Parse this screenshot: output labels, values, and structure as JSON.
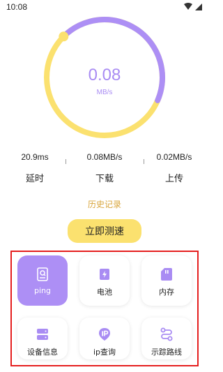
{
  "status_bar": {
    "time": "10:08"
  },
  "gauge": {
    "value": "0.08",
    "unit": "MB/s",
    "level_percent": 88
  },
  "stats": [
    {
      "value": "20.9ms",
      "label": "延时"
    },
    {
      "value": "0.08MB/s",
      "label": "下载"
    },
    {
      "value": "0.02MB/s",
      "label": "上传"
    }
  ],
  "history_label": "历史记录",
  "test_button_label": "立即测速",
  "tools": [
    {
      "label": "ping",
      "icon": "document-search-icon",
      "active": true
    },
    {
      "label": "电池",
      "icon": "battery-icon",
      "active": false
    },
    {
      "label": "内存",
      "icon": "sd-card-icon",
      "active": false
    },
    {
      "label": "设备信息",
      "icon": "server-icon",
      "active": false
    },
    {
      "label": "ip查询",
      "icon": "ip-icon",
      "active": false
    },
    {
      "label": "示踪路线",
      "icon": "route-icon",
      "active": false
    }
  ],
  "colors": {
    "accent_purple": "#ad8ff5",
    "accent_yellow": "#fbe16f",
    "history_text": "#d8a43a",
    "highlight_border": "#e51e1e"
  }
}
